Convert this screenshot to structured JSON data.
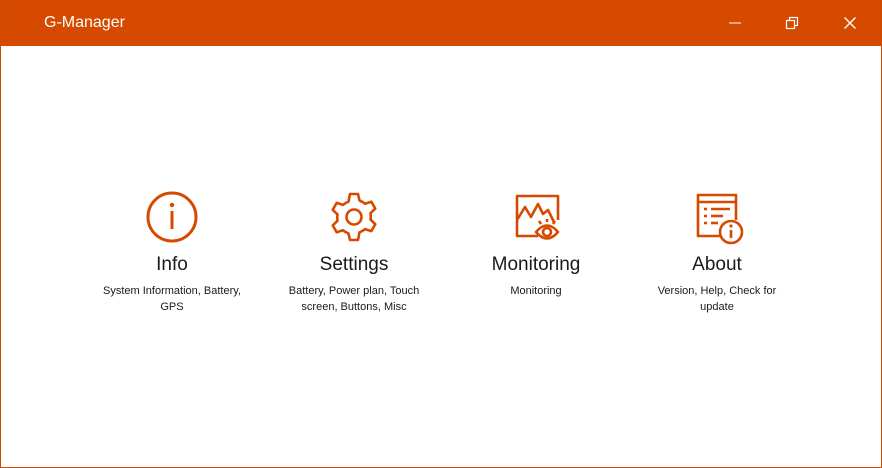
{
  "window": {
    "title": "G-Manager"
  },
  "controls": {
    "minimize_icon": "minimize-icon",
    "maximize_icon": "restore-icon",
    "close_icon": "close-icon"
  },
  "tiles": [
    {
      "icon": "info-circle-icon",
      "label": "Info",
      "description": "System Information, Battery, GPS"
    },
    {
      "icon": "gear-icon",
      "label": "Settings",
      "description": "Battery, Power plan, Touch screen, Buttons, Misc"
    },
    {
      "icon": "monitoring-chart-eye-icon",
      "label": "Monitoring",
      "description": "Monitoring"
    },
    {
      "icon": "about-document-info-icon",
      "label": "About",
      "description": "Version, Help, Check for update"
    }
  ],
  "colors": {
    "accent": "#d64a00",
    "text": "#1a1a1a",
    "background": "#ffffff"
  }
}
